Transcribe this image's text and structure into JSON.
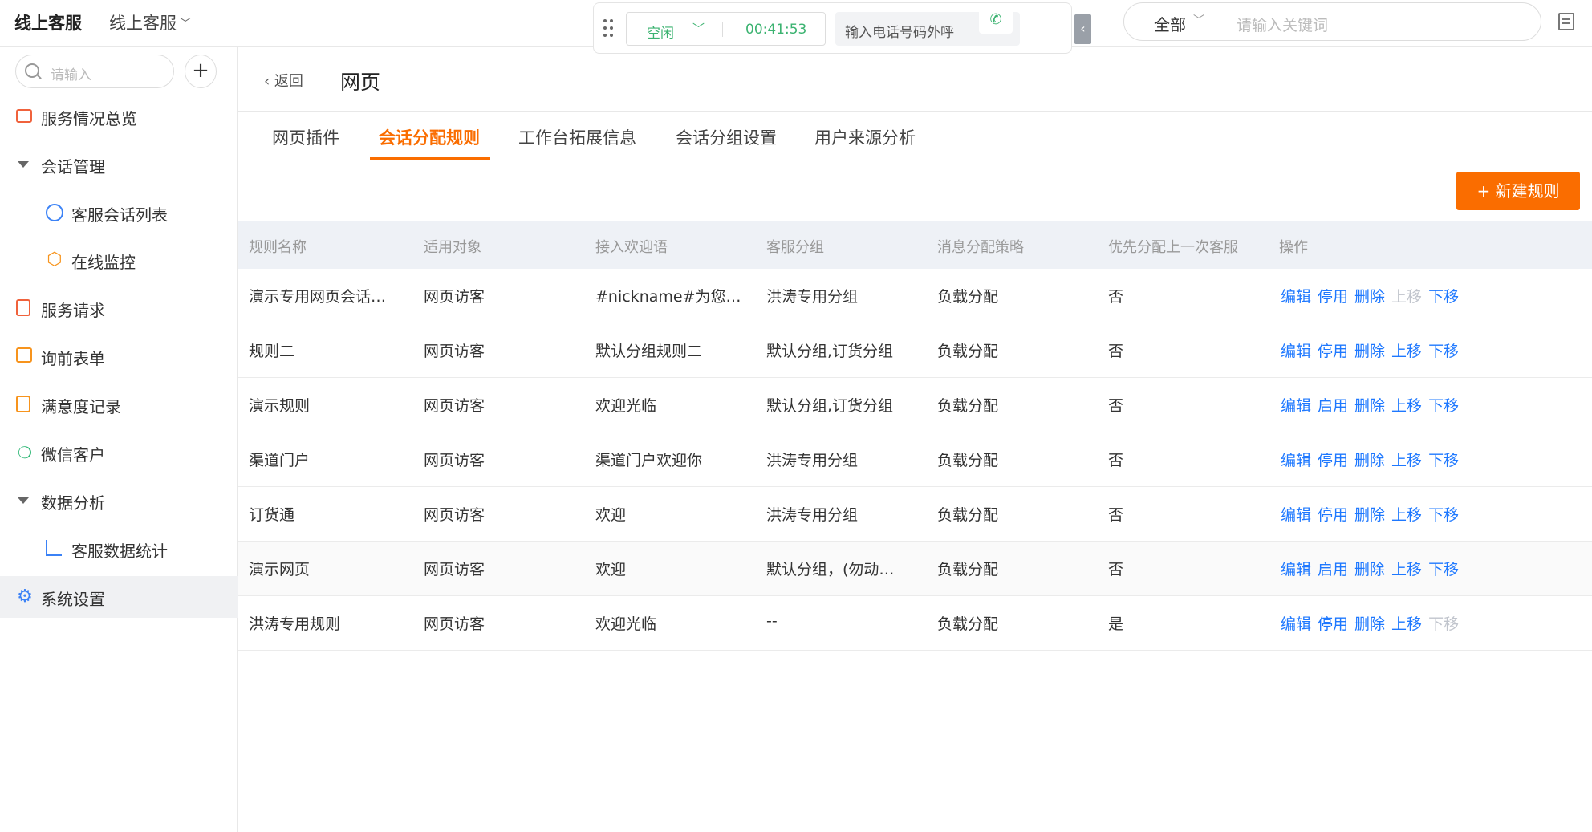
{
  "topbar": {
    "brand": "线上客服",
    "app_switch": "线上客服",
    "call": {
      "status": "空闲",
      "timer": "00:41:53",
      "phone_placeholder": "输入电话号码外呼"
    },
    "search": {
      "scope": "全部",
      "placeholder": "请输入关键词"
    }
  },
  "sidebar": {
    "search_placeholder": "请输入",
    "items": [
      {
        "label": "服务情况总览",
        "icon": "monitor-icon"
      },
      {
        "label": "会话管理",
        "icon": "caret-down-icon"
      },
      {
        "label": "客服会话列表",
        "icon": "chat-bubble-icon"
      },
      {
        "label": "在线监控",
        "icon": "hexagon-monitor-icon"
      },
      {
        "label": "服务请求",
        "icon": "request-doc-icon"
      },
      {
        "label": "询前表单",
        "icon": "form-icon"
      },
      {
        "label": "满意度记录",
        "icon": "satisfaction-doc-icon"
      },
      {
        "label": "微信客户",
        "icon": "wechat-icon"
      },
      {
        "label": "数据分析",
        "icon": "caret-down-icon"
      },
      {
        "label": "客服数据统计",
        "icon": "bar-chart-icon"
      },
      {
        "label": "系统设置",
        "icon": "gear-icon"
      }
    ]
  },
  "header": {
    "back": "返回",
    "title": "网页"
  },
  "tabs": [
    "网页插件",
    "会话分配规则",
    "工作台拓展信息",
    "会话分组设置",
    "用户来源分析"
  ],
  "new_button": "+ 新建规则",
  "table": {
    "columns": [
      "规则名称",
      "适用对象",
      "接入欢迎语",
      "客服分组",
      "消息分配策略",
      "优先分配上一次客服",
      "操作"
    ],
    "rows": [
      {
        "name": "演示专用网页会话…",
        "target": "网页访客",
        "welcome": "#nickname#为您…",
        "group": "洪涛专用分组",
        "strategy": "负载分配",
        "priority": "否",
        "toggle": "停用"
      },
      {
        "name": "规则二",
        "target": "网页访客",
        "welcome": "默认分组规则二",
        "group": "默认分组,订货分组",
        "strategy": "负载分配",
        "priority": "否",
        "toggle": "停用"
      },
      {
        "name": "演示规则",
        "target": "网页访客",
        "welcome": "欢迎光临",
        "group": "默认分组,订货分组",
        "strategy": "负载分配",
        "priority": "否",
        "toggle": "启用"
      },
      {
        "name": "渠道门户",
        "target": "网页访客",
        "welcome": "渠道门户欢迎你",
        "group": "洪涛专用分组",
        "strategy": "负载分配",
        "priority": "否",
        "toggle": "停用"
      },
      {
        "name": "订货通",
        "target": "网页访客",
        "welcome": "欢迎",
        "group": "洪涛专用分组",
        "strategy": "负载分配",
        "priority": "否",
        "toggle": "停用"
      },
      {
        "name": "演示网页",
        "target": "网页访客",
        "welcome": "欢迎",
        "group": "默认分组，(勿动…",
        "strategy": "负载分配",
        "priority": "否",
        "toggle": "启用"
      },
      {
        "name": "洪涛专用规则",
        "target": "网页访客",
        "welcome": "欢迎光临",
        "group": "--",
        "strategy": "负载分配",
        "priority": "是",
        "toggle": "停用"
      }
    ],
    "ops": {
      "edit": "编辑",
      "delete": "删除",
      "up": "上移",
      "down": "下移"
    }
  },
  "colors": {
    "accent": "#fa6d00",
    "link": "#1e78ff",
    "idle_green": "#3cb371"
  }
}
